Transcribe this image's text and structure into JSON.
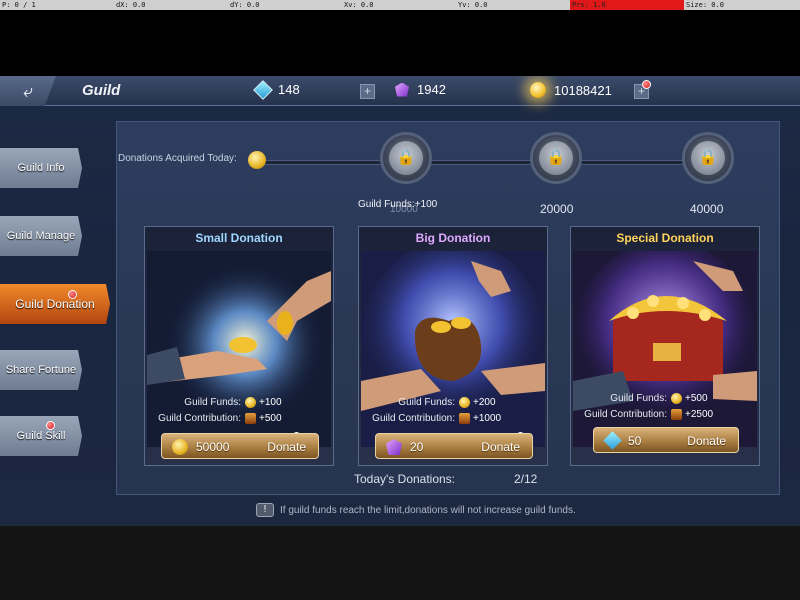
{
  "debug": [
    "P: 0 / 1",
    "dX: 0.0",
    "dY: 0.0",
    "Xv: 0.0",
    "Yv: 0.0",
    "Prs: 1.0",
    "Size: 0.0"
  ],
  "header": {
    "title": "Guild",
    "diamonds": "148",
    "gems": "1942",
    "gold": "10188421"
  },
  "sidebar": {
    "items": [
      {
        "label": "Guild Info"
      },
      {
        "label": "Guild Manage"
      },
      {
        "label": "Guild Donation"
      },
      {
        "label": "Share Fortune"
      },
      {
        "label": "Guild Skill"
      }
    ]
  },
  "progress": {
    "label": "Donations Acquired Today:",
    "funds_note": "Guild Funds:+100",
    "milestones": [
      "10000",
      "20000",
      "40000"
    ]
  },
  "cards": [
    {
      "title": "Small Donation",
      "funds_label": "Guild Funds:",
      "funds": "+100",
      "contrib_label": "Guild Contribution:",
      "contrib": "+500",
      "cost": "50000",
      "action": "Donate"
    },
    {
      "title": "Big Donation",
      "funds_label": "Guild Funds:",
      "funds": "+200",
      "contrib_label": "Guild Contribution:",
      "contrib": "+1000",
      "cost": "20",
      "action": "Donate"
    },
    {
      "title": "Special Donation",
      "funds_label": "Guild Funds:",
      "funds": "+500",
      "contrib_label": "Guild Contribution:",
      "contrib": "+2500",
      "cost": "50",
      "action": "Donate"
    }
  ],
  "today": {
    "label": "Today's Donations:",
    "value": "2/12"
  },
  "footnote": "If guild funds reach the limit,donations will not increase guild funds.",
  "colors": {
    "small_title": "#9fd7ff",
    "big_title": "#e0a8ff",
    "special_title": "#ffd35a"
  }
}
